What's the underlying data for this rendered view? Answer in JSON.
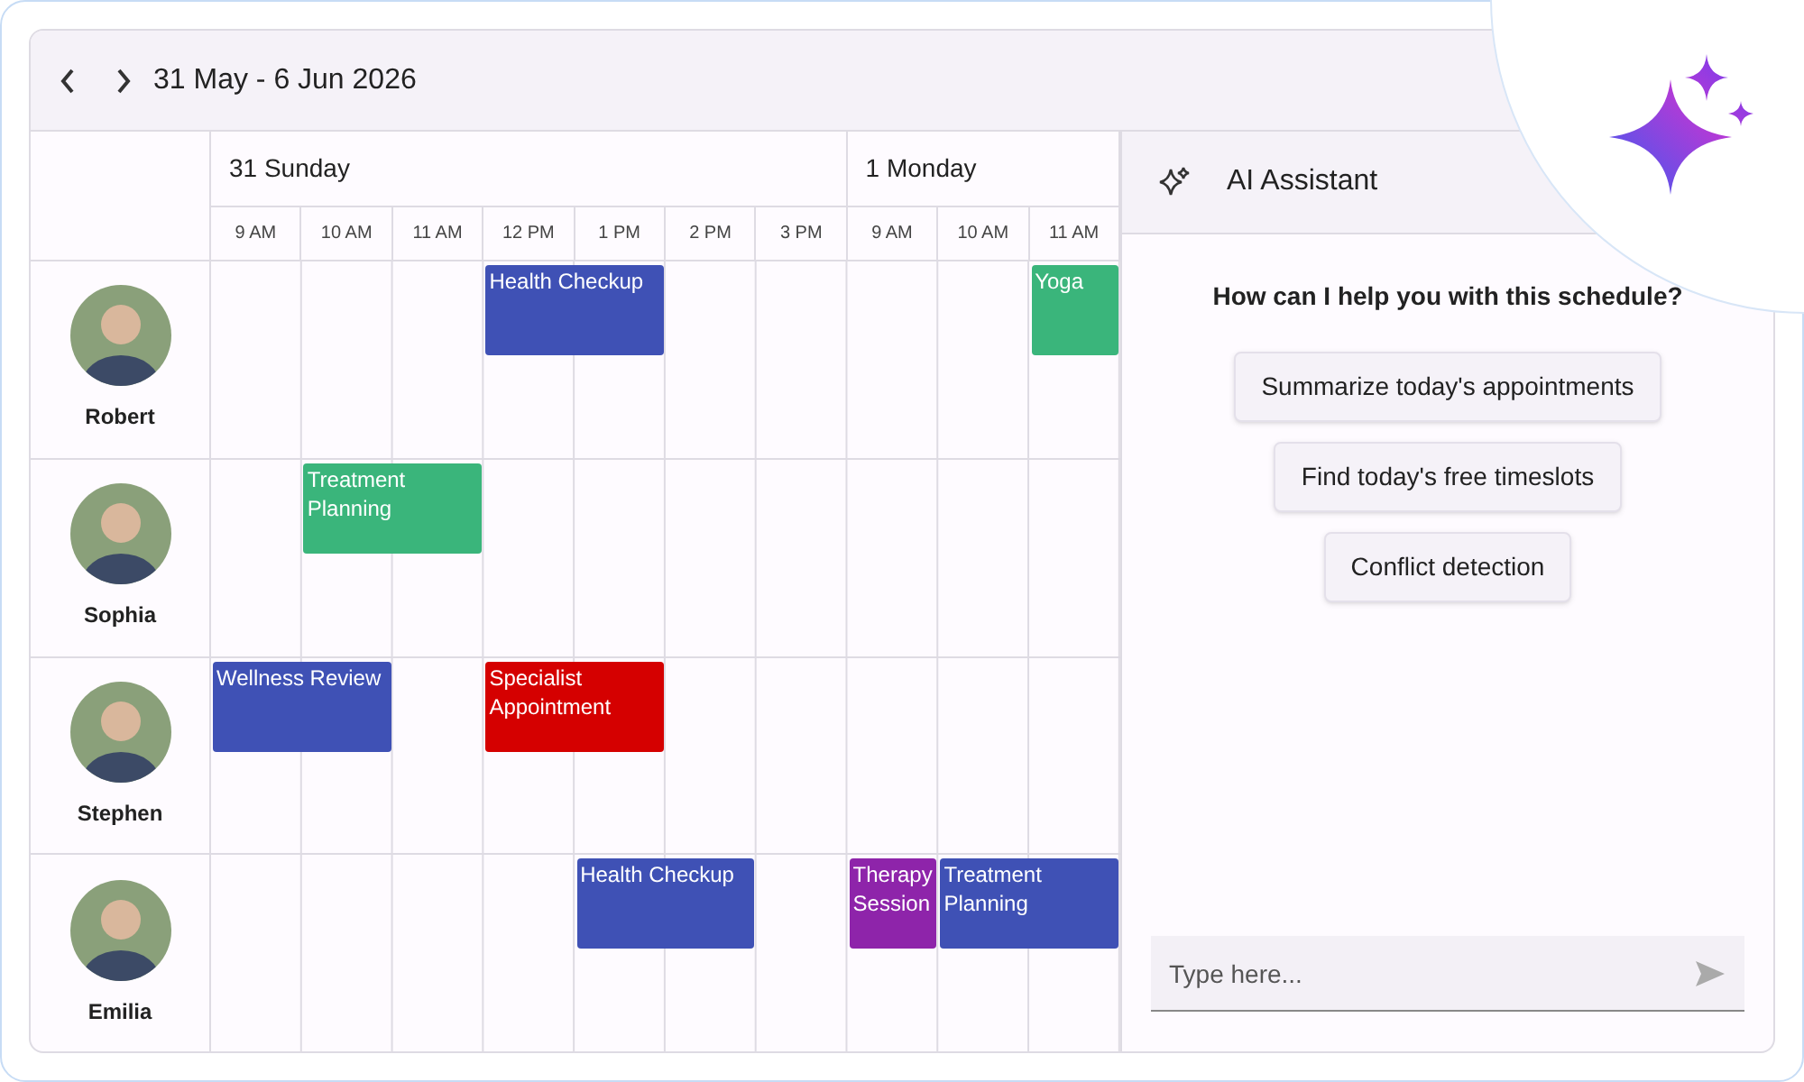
{
  "toolbar": {
    "date_range": "31 May - 6 Jun 2026"
  },
  "days": [
    {
      "label": "31 Sunday",
      "slots": [
        "9 AM",
        "10 AM",
        "11 AM",
        "12 PM",
        "1 PM",
        "2 PM",
        "3 PM"
      ]
    },
    {
      "label": "1 Monday",
      "slots": [
        "9 AM",
        "10 AM",
        "11 AM"
      ]
    }
  ],
  "resources": [
    {
      "name": "Robert",
      "events": [
        {
          "title": "Health Checkup",
          "color": "#3f51b5"
        },
        {
          "title": "Yoga",
          "color": "#3ab57b"
        }
      ]
    },
    {
      "name": "Sophia",
      "events": [
        {
          "title": "Treatment Planning",
          "color": "#3ab57b"
        }
      ]
    },
    {
      "name": "Stephen",
      "events": [
        {
          "title": "Wellness Review",
          "color": "#3f51b5"
        },
        {
          "title": "Specialist Appointment",
          "color": "#d50000"
        }
      ]
    },
    {
      "name": "Emilia",
      "events": [
        {
          "title": "Health Checkup",
          "color": "#3f51b5"
        },
        {
          "title": "Therapy Session",
          "color": "#8e24aa"
        },
        {
          "title": "Treatment Planning",
          "color": "#3f51b5"
        }
      ]
    }
  ],
  "assistant": {
    "title": "AI Assistant",
    "prompt": "How can I help you with this schedule?",
    "suggestions": [
      "Summarize today's appointments",
      "Find today's free timeslots",
      "Conflict detection"
    ],
    "input": {
      "placeholder": "Type here..."
    }
  }
}
